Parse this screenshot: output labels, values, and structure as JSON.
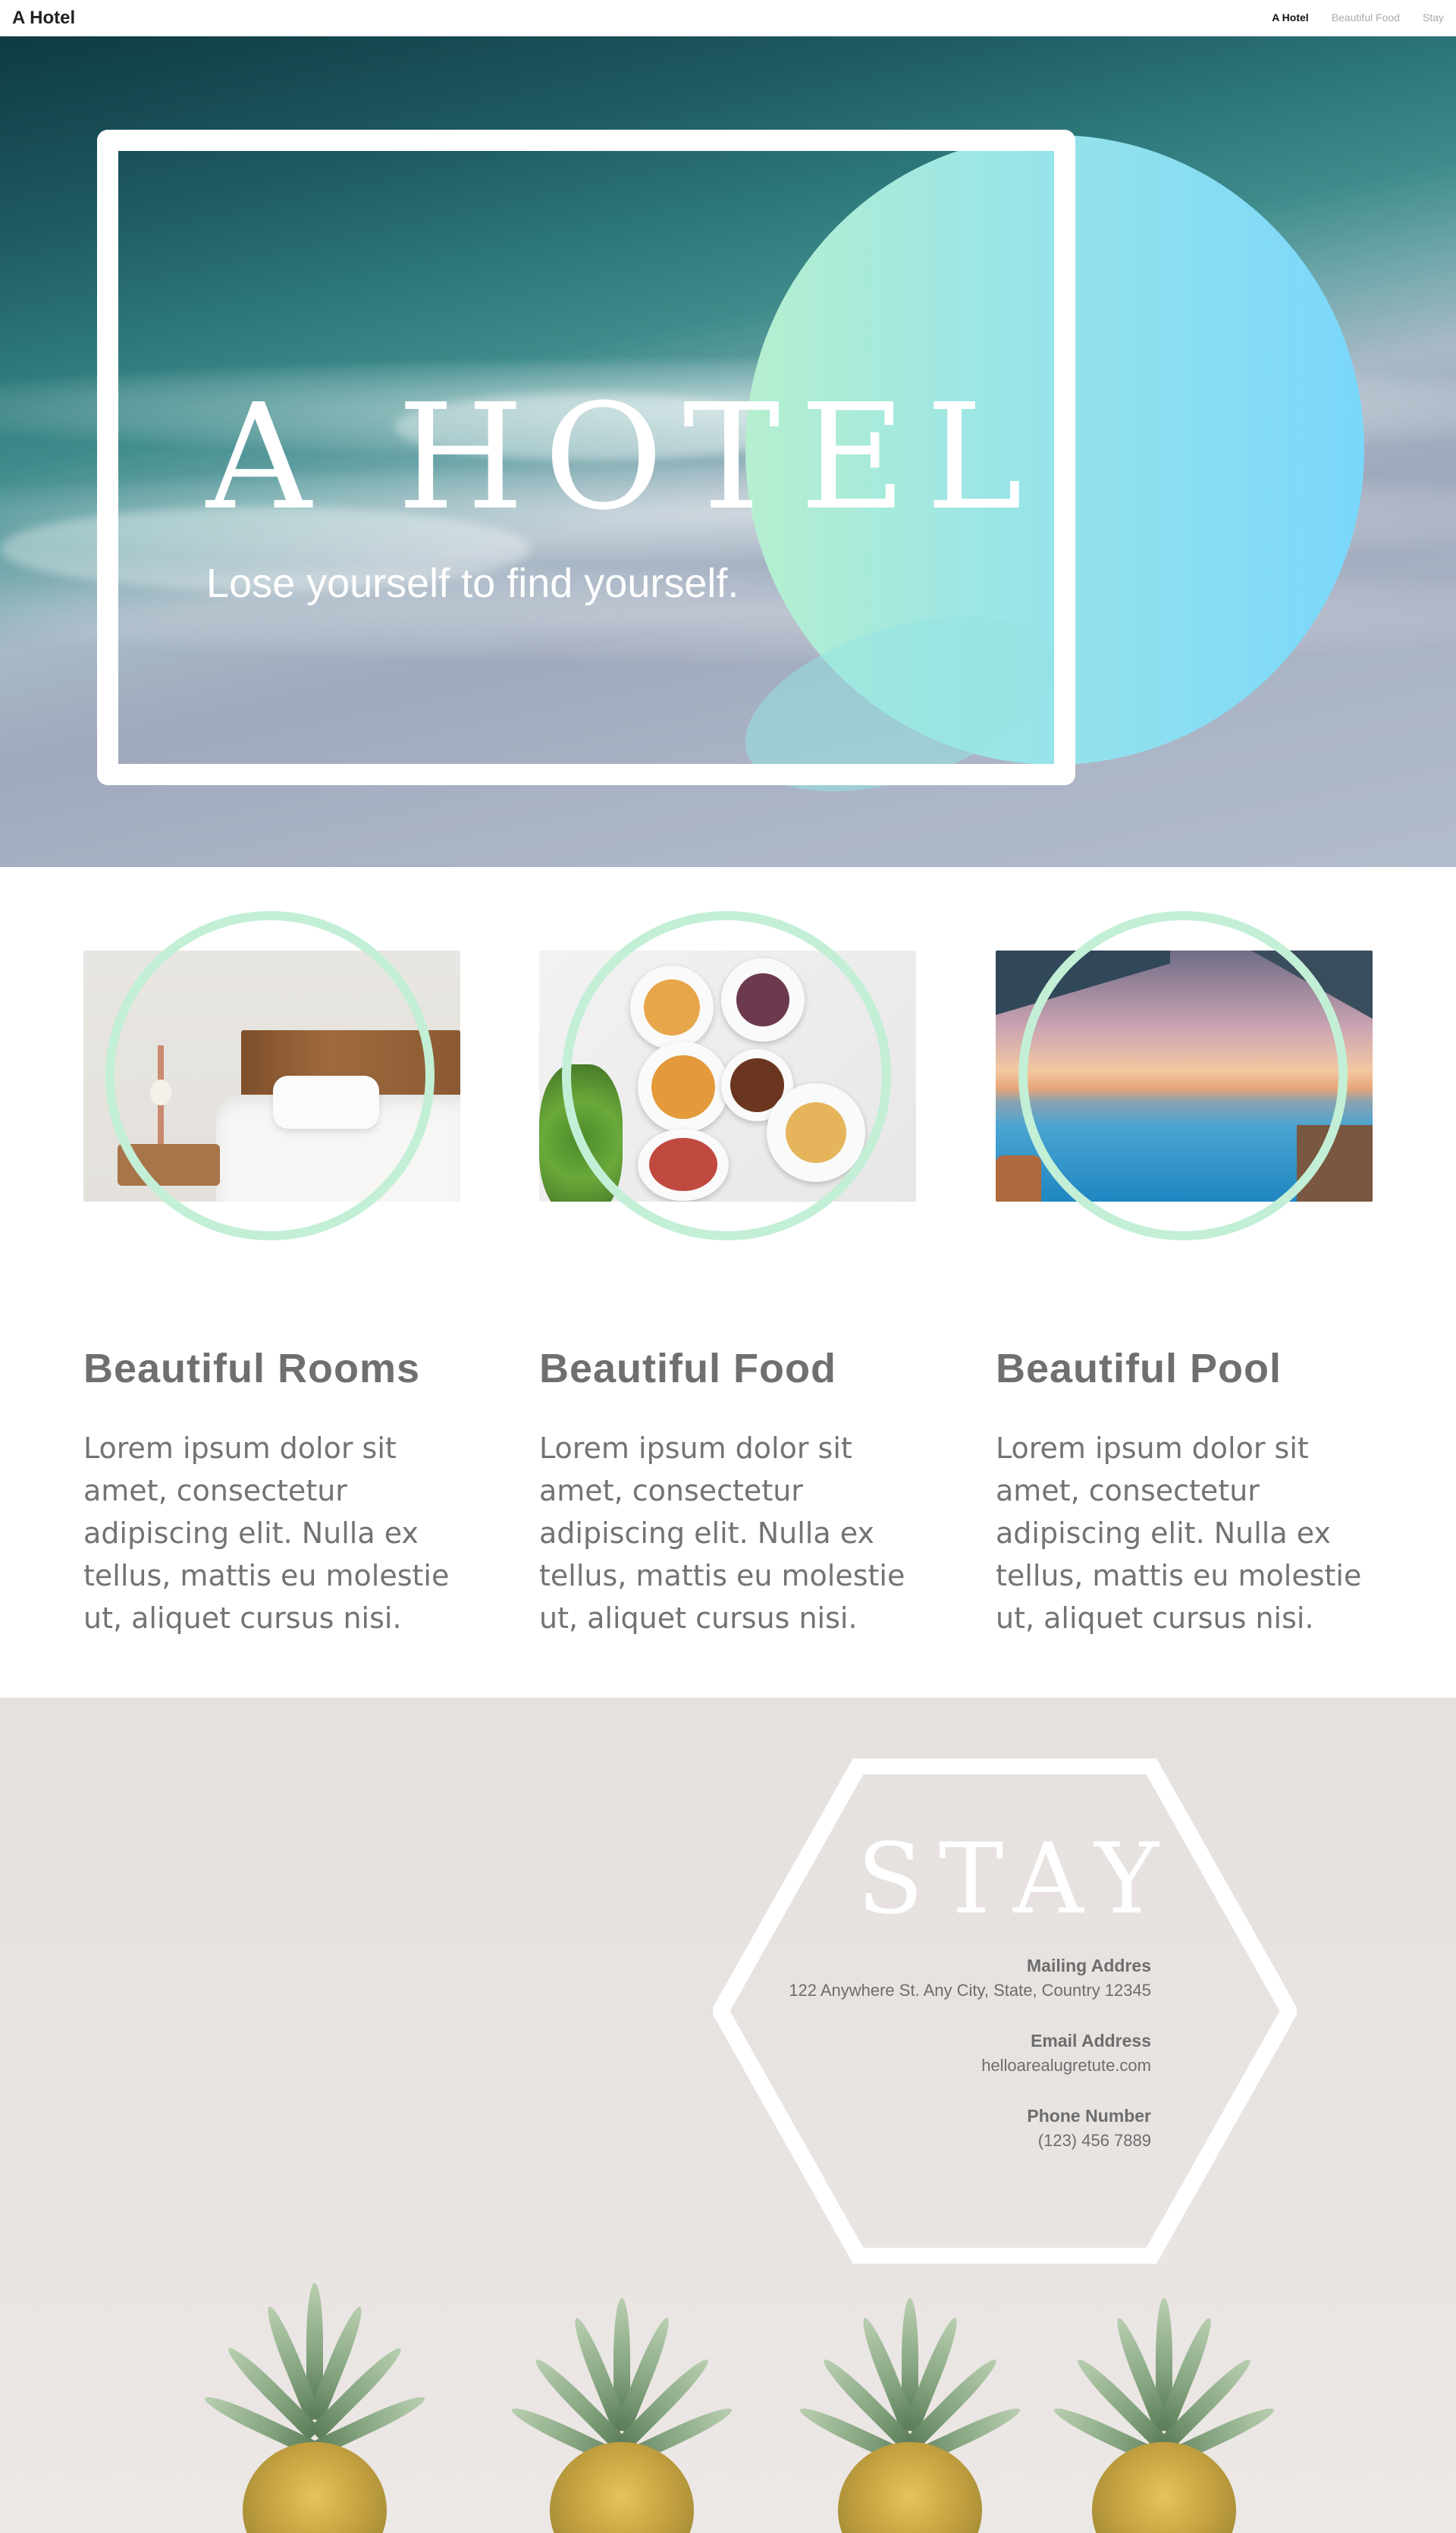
{
  "nav": {
    "brand": "A Hotel",
    "links": [
      {
        "label": "A Hotel",
        "active": true
      },
      {
        "label": "Beautiful Food",
        "active": false
      },
      {
        "label": "Stay",
        "active": false
      }
    ]
  },
  "hero": {
    "title": "A HOTEL",
    "subtitle": "Lose yourself to find yourself."
  },
  "features": [
    {
      "title": "Beautiful Rooms",
      "text": "Lorem ipsum dolor sit amet, consectetur adipiscing elit. Nulla ex tellus, mattis eu molestie ut, aliquet cursus nisi.",
      "image_icon": "bedroom-photo"
    },
    {
      "title": "Beautiful Food",
      "text": "Lorem ipsum dolor sit amet, consectetur adipiscing elit. Nulla ex tellus, mattis eu molestie ut, aliquet cursus nisi.",
      "image_icon": "food-table-photo"
    },
    {
      "title": "Beautiful Pool",
      "text": "Lorem ipsum dolor sit amet, consectetur adipiscing elit. Nulla ex tellus, mattis eu molestie ut, aliquet cursus nisi.",
      "image_icon": "pool-photo"
    }
  ],
  "stay": {
    "title": "STAY",
    "mailing_label": "Mailing Addres",
    "mailing_value": "122 Anywhere St. Any City, State, Country 12345",
    "email_label": "Email Address",
    "email_value": "helloarealugretute.com",
    "phone_label": "Phone Number",
    "phone_value": "(123) 456 7889"
  },
  "colors": {
    "accent_mint": "#c2efd6",
    "gradient_start": "#b5efcf",
    "gradient_end": "#7ad7fb",
    "text_gray": "#6f6f6f"
  }
}
